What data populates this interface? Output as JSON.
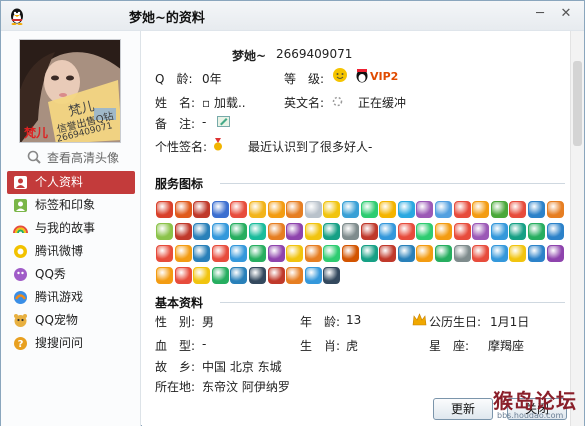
{
  "window": {
    "title": "梦她~的资料",
    "min_label": "─",
    "close_label": "✕"
  },
  "left": {
    "avatar_overlay_text": "梵儿",
    "avatar_card_text": "信誉出售Q钻",
    "avatar_card_number": "2669409071",
    "avatar_corner_text": "梵儿",
    "hd_link": "查看高清头像",
    "nav": [
      {
        "label": "个人资料",
        "icon": "person-icon",
        "color": "#d9534f"
      },
      {
        "label": "标签和印象",
        "icon": "tag-icon",
        "color": "#7ab648"
      },
      {
        "label": "与我的故事",
        "icon": "rainbow-icon",
        "color": "#f0a030"
      },
      {
        "label": "腾讯微博",
        "icon": "weibo-icon",
        "color": "#f2c200"
      },
      {
        "label": "QQ秀",
        "icon": "qqshow-icon",
        "color": "#a05cc8"
      },
      {
        "label": "腾讯游戏",
        "icon": "game-icon",
        "color": "#f08a1a"
      },
      {
        "label": "QQ宠物",
        "icon": "pet-icon",
        "color": "#e8b040"
      },
      {
        "label": "搜搜问问",
        "icon": "question-icon",
        "color": "#e8a020"
      }
    ]
  },
  "profile": {
    "nickname": "梦她~",
    "qq": "2669409071",
    "age_label": "Q　龄:",
    "age_value": "0年",
    "level_label": "等　级:",
    "vip_badge": "VIP2",
    "name_label": "姓　名:",
    "name_value": "▫ 加载..",
    "english_name_label": "英文名:",
    "english_name_value": "正在缓冲",
    "note_label": "备　注:",
    "note_value": "-",
    "signature_label": "个性签名:",
    "signature_value": "最近认识到了很多好人-"
  },
  "service_icons": {
    "title": "服务图标",
    "rows": [
      [
        "#d9412b",
        "#e05a1c",
        "#c0392b",
        "#3b6fd0",
        "#e74c3c",
        "#f2b41a",
        "#f39c12",
        "#e67e22",
        "#b9c2cb",
        "#f1c40f",
        "#39a0d6",
        "#2ecc71",
        "#f4b400",
        "#2aa8e0",
        "#9b59b6",
        "#52a0e0",
        "#e74c3c",
        "#f39c12",
        "#4aa83a",
        "#e74c3c",
        "#2c82c9",
        "#e67e22"
      ],
      [
        "#8bc34a",
        "#c0392b",
        "#2980b9",
        "#3498db",
        "#27ae60",
        "#1abc9c",
        "#e67e22",
        "#8e44ad",
        "#f1c40f",
        "#16a085",
        "#7f8c8d",
        "#c0392b",
        "#3498db",
        "#e74c3c",
        "#2ecc71",
        "#f39c12",
        "#e74c3c",
        "#9b59b6",
        "#3498db",
        "#16a085",
        "#27ae60",
        "#2c82c9"
      ],
      [
        "#e74c3c",
        "#f39c12",
        "#2980b9",
        "#e74c3c",
        "#3498db",
        "#27ae60",
        "#8e44ad",
        "#f1c40f",
        "#e67e22",
        "#2ecc71",
        "#d35400",
        "#16a085",
        "#c0392b",
        "#2980b9",
        "#f39c12",
        "#27ae60",
        "#7f8c8d",
        "#e74c3c",
        "#3498db",
        "#f1c40f",
        "#2c82c9",
        "#8e44ad"
      ],
      [
        "#f39c12",
        "#e74c3c",
        "#f1c40f",
        "#27ae60",
        "#2980b9",
        "#34495e",
        "#c0392b",
        "#e67e22",
        "#3498db",
        "#34495e"
      ]
    ]
  },
  "basic_info": {
    "title": "基本资料",
    "gender_label": "性　别:",
    "gender_value": "男",
    "age_label": "年　龄:",
    "age_value": "13",
    "birthday_label": "公历生日:",
    "birthday_value": "1月1日",
    "blood_label": "血　型:",
    "blood_value": "-",
    "zodiac_label": "生　肖:",
    "zodiac_value": "虎",
    "constellation_label": "星　座:",
    "constellation_value": "摩羯座",
    "hometown_label": "故　乡:",
    "hometown_value": "中国 北京 东城",
    "location_label": "所在地:",
    "location_value": "东帝汶 阿伊纳罗"
  },
  "buttons": {
    "refresh": "更新",
    "close": "关闭"
  },
  "watermark": {
    "text": "猴岛论坛",
    "url": "bbs.houdao.com"
  }
}
